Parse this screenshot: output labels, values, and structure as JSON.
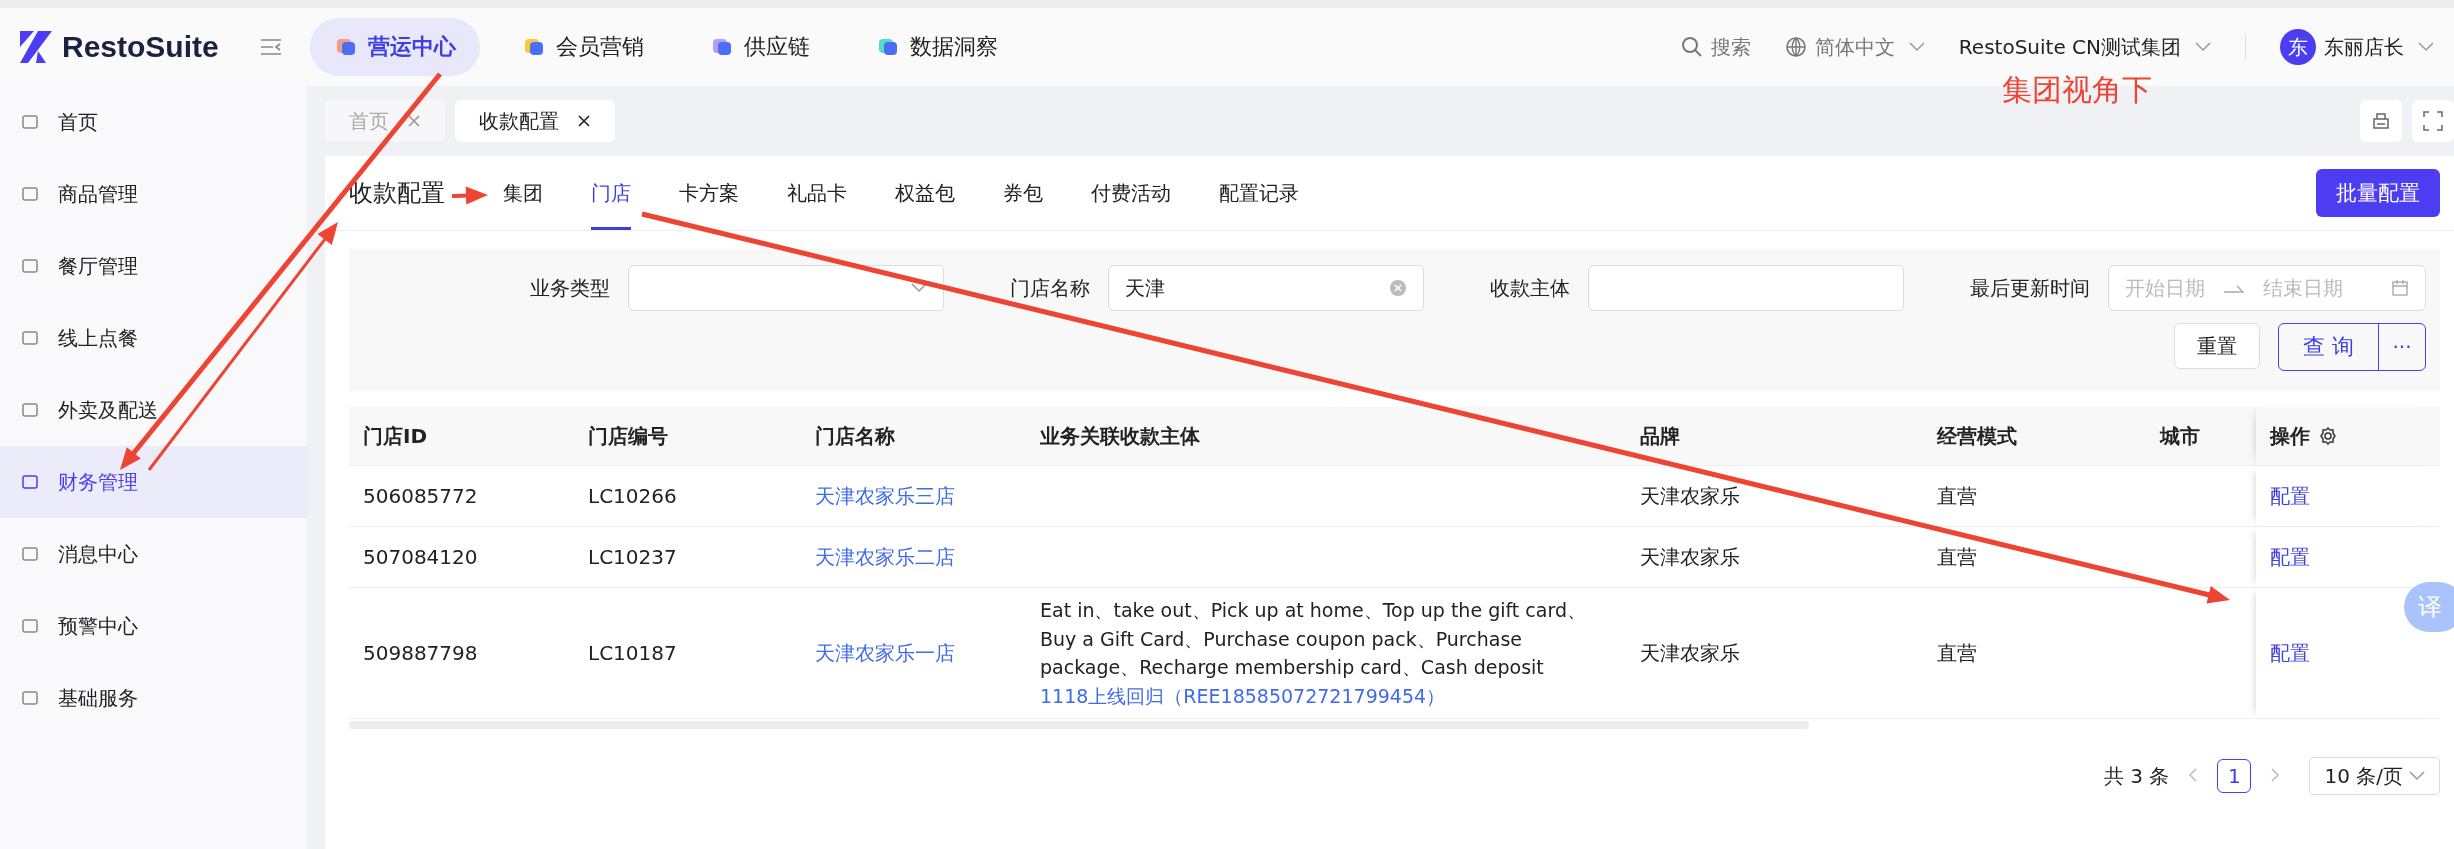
{
  "brand": "RestoSuite",
  "top_nav": [
    {
      "label": "营运中心",
      "selected": true
    },
    {
      "label": "会员营销",
      "selected": false
    },
    {
      "label": "供应链",
      "selected": false
    },
    {
      "label": "数据洞察",
      "selected": false
    }
  ],
  "header": {
    "search": "搜索",
    "language": "简体中文",
    "org": "RestoSuite CN测试集团",
    "avatar": "东",
    "user": "东丽店长"
  },
  "annotation": "集团视角下",
  "sidebar": [
    {
      "label": "首页",
      "selected": false
    },
    {
      "label": "商品管理",
      "selected": false
    },
    {
      "label": "餐厅管理",
      "selected": false
    },
    {
      "label": "线上点餐",
      "selected": false
    },
    {
      "label": "外卖及配送",
      "selected": false
    },
    {
      "label": "财务管理",
      "selected": true
    },
    {
      "label": "消息中心",
      "selected": false
    },
    {
      "label": "预警中心",
      "selected": false
    },
    {
      "label": "基础服务",
      "selected": false
    }
  ],
  "page_tabs": [
    {
      "label": "首页",
      "selected": false
    },
    {
      "label": "收款配置",
      "selected": true
    }
  ],
  "page_title": "收款配置",
  "sub_tabs": [
    {
      "label": "集团",
      "selected": false
    },
    {
      "label": "门店",
      "selected": true
    },
    {
      "label": "卡方案",
      "selected": false
    },
    {
      "label": "礼品卡",
      "selected": false
    },
    {
      "label": "权益包",
      "selected": false
    },
    {
      "label": "券包",
      "selected": false
    },
    {
      "label": "付费活动",
      "selected": false
    },
    {
      "label": "配置记录",
      "selected": false
    }
  ],
  "batch_button": "批量配置",
  "filters": [
    {
      "kind": "select",
      "label": "业务类型"
    },
    {
      "kind": "text",
      "label": "门店名称",
      "value": "天津",
      "clearable": true
    },
    {
      "kind": "text",
      "label": "收款主体",
      "clearable": false
    },
    {
      "kind": "daterange",
      "label": "最后更新时间",
      "start_placeholder": "开始日期",
      "end_placeholder": "结束日期"
    }
  ],
  "reset_button": "重置",
  "query_button": "查 询",
  "more_button": "···",
  "table": {
    "columns": [
      "门店ID",
      "门店编号",
      "门店名称",
      "业务关联收款主体",
      "品牌",
      "经营模式",
      "城市",
      "操作"
    ],
    "rows": [
      {
        "id": "506085772",
        "code": "LC10266",
        "name": "天津农家乐三店",
        "brand": "天津农家乐",
        "mode": "直营",
        "action": "配置"
      },
      {
        "id": "507084120",
        "code": "LC10237",
        "name": "天津农家乐二店",
        "brand": "天津农家乐",
        "mode": "直营",
        "action": "配置"
      },
      {
        "id": "509887798",
        "code": "LC10187",
        "name": "天津农家乐一店",
        "entity": "Eat in、take out、Pick up at home、Top up the gift card、Buy a Gift Card、Purchase coupon pack、Purchase package、Recharge membership card、Cash deposit",
        "entity_link": "1118上线回归（REE18585072721799454）",
        "brand": "天津农家乐",
        "mode": "直营",
        "action": "配置"
      }
    ]
  },
  "pagination": {
    "total": "共 3 条",
    "page": "1",
    "page_size": "10 条/页"
  },
  "translate_button": "译"
}
